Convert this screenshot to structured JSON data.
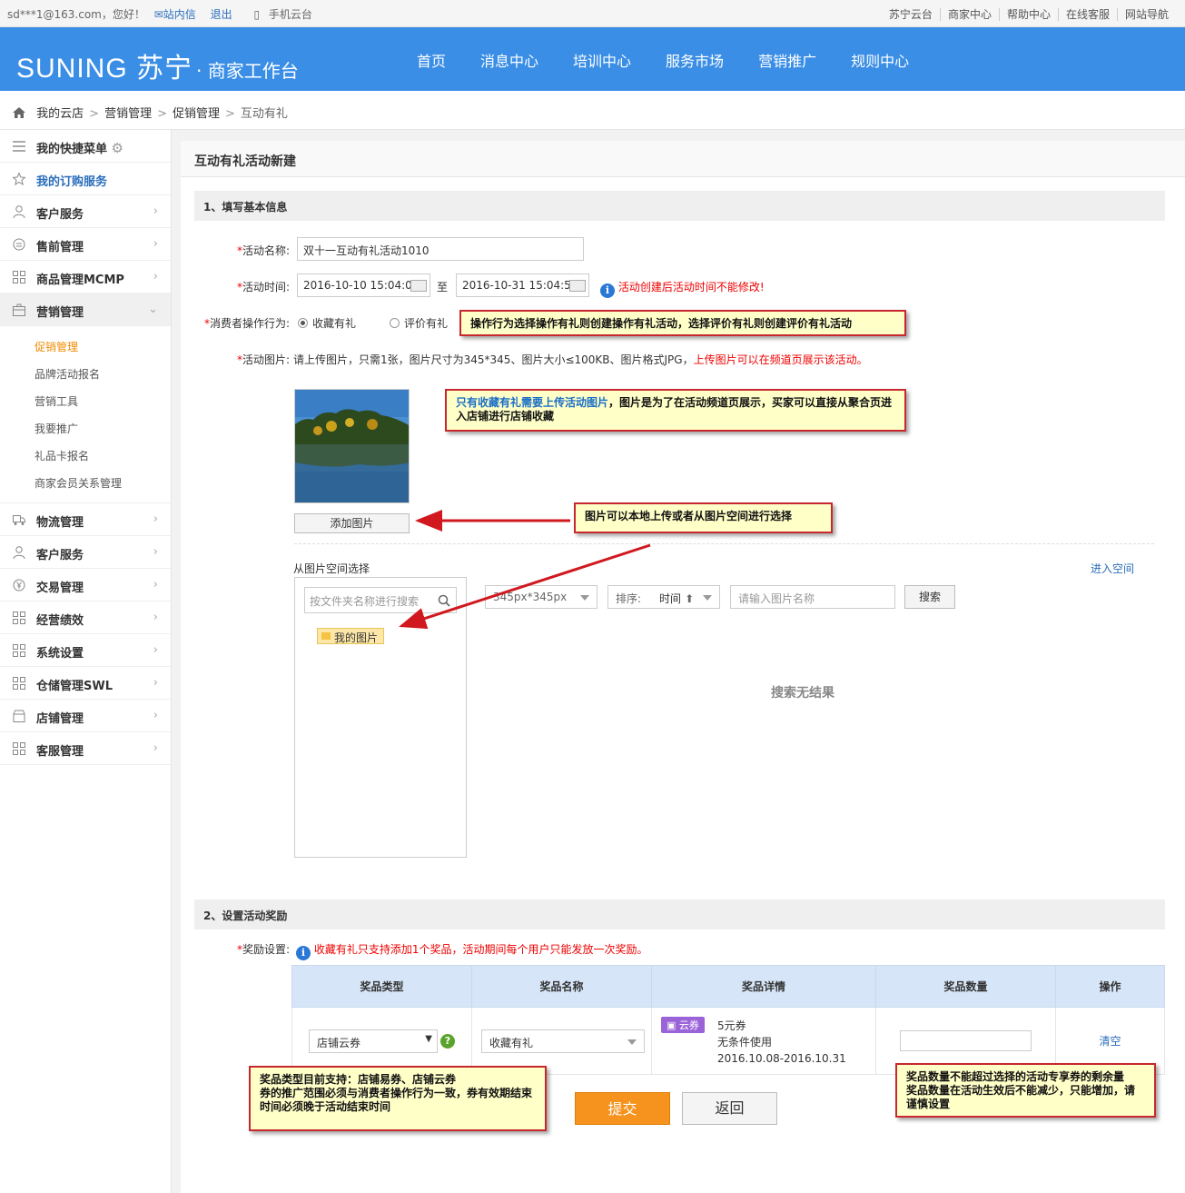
{
  "topbar": {
    "user": "sd***1@163.com，您好！",
    "messages": "站内信",
    "logout": "退出",
    "mobile": "手机云台",
    "links": [
      "苏宁云台",
      "商家中心",
      "帮助中心",
      "在线客服",
      "网站导航"
    ]
  },
  "header": {
    "brand": "SUNING 苏宁",
    "sub": "· 商家工作台",
    "nav": [
      "首页",
      "消息中心",
      "培训中心",
      "服务市场",
      "营销推广",
      "规则中心"
    ],
    "color": "#3a8ee6"
  },
  "breadcrumb": [
    "我的云店",
    "营销管理",
    "促销管理",
    "互动有礼"
  ],
  "sidebar": {
    "top": [
      {
        "label": "我的快捷菜单",
        "icon": "menu-icon"
      },
      {
        "label": "我的订购服务",
        "icon": "star-icon"
      },
      {
        "label": "客户服务",
        "icon": "user-icon"
      },
      {
        "label": "售前管理",
        "icon": "presale-icon"
      },
      {
        "label": "商品管理MCMP",
        "icon": "grid-icon"
      },
      {
        "label": "营销管理",
        "icon": "briefcase-icon"
      }
    ],
    "sub": [
      "促销管理",
      "品牌活动报名",
      "营销工具",
      "我要推广",
      "礼品卡报名",
      "商家会员关系管理"
    ],
    "bottom": [
      {
        "label": "物流管理",
        "icon": "truck-icon"
      },
      {
        "label": "客户服务",
        "icon": "user-icon"
      },
      {
        "label": "交易管理",
        "icon": "yen-icon"
      },
      {
        "label": "经营绩效",
        "icon": "grid-icon"
      },
      {
        "label": "系统设置",
        "icon": "grid-icon"
      },
      {
        "label": "仓储管理SWL",
        "icon": "grid-icon"
      },
      {
        "label": "店铺管理",
        "icon": "store-icon"
      },
      {
        "label": "客服管理",
        "icon": "grid-icon"
      }
    ]
  },
  "page": {
    "title": "互动有礼活动新建",
    "section1": "1、填写基本信息",
    "section2": "2、设置活动奖励"
  },
  "form": {
    "name_label": "活动名称:",
    "name_value": "双十一互动有礼活动1010",
    "time_label": "活动时间:",
    "start": "2016-10-10 15:04:00",
    "to": "至",
    "end": "2016-10-31 15:04:59",
    "time_warning": "活动创建后活动时间不能修改!",
    "action_label": "消费者操作行为:",
    "action_opt1": "收藏有礼",
    "action_opt2": "评价有礼",
    "image_label": "活动图片:",
    "image_hint": "请上传图片，只需1张，图片尺寸为345*345、图片大小≤100KB、图片格式JPG，",
    "image_hint_red": "上传图片可以在频道页展示该活动。",
    "add_image": "添加图片",
    "from_space": "从图片空间选择",
    "enter_space": "进入空间",
    "folder_search_placeholder": "按文件夹名称进行搜索",
    "folder": "我的图片",
    "size_select": "345px*345px",
    "sort_label": "排序:",
    "sort_value": "时间",
    "image_name_placeholder": "请输入图片名称",
    "search_btn": "搜索",
    "no_result": "搜索无结果",
    "reward_label": "奖励设置:",
    "reward_note": "收藏有礼只支持添加1个奖品，活动期间每个用户只能发放一次奖励。"
  },
  "table": {
    "headers": [
      "奖品类型",
      "奖品名称",
      "奖品详情",
      "奖品数量",
      "操作"
    ],
    "row": {
      "type": "店铺云券",
      "name": "收藏有礼",
      "tag": "云券",
      "detail1": "5元券",
      "detail2": "无条件使用",
      "detail3": "2016.10.08-2016.10.31",
      "qty": "",
      "op": "清空"
    }
  },
  "buttons": {
    "submit": "提交",
    "back": "返回"
  },
  "tips": {
    "t1": "操作行为选择操作有礼则创建操作有礼活动，选择评价有礼则创建评价有礼活动",
    "t2_blue": "只有收藏有礼需要上传活动图片",
    "t2_rest": "，图片是为了在活动频道页展示，买家可以直接从聚合页进入店铺进行店铺收藏",
    "t3": "图片可以本地上传或者从图片空间进行选择",
    "t4_l1": "奖品类型目前支持：店铺易券、店铺云券",
    "t4_l2": "券的推广范围必须与消费者操作行为一致，券有效期结束时间必须晚于活动结束时间",
    "t5_l1": "奖品数量不能超过选择的活动专享券的剩余量",
    "t5_l2": "奖品数量在活动生效后不能减少，只能增加，请谨慎设置"
  }
}
